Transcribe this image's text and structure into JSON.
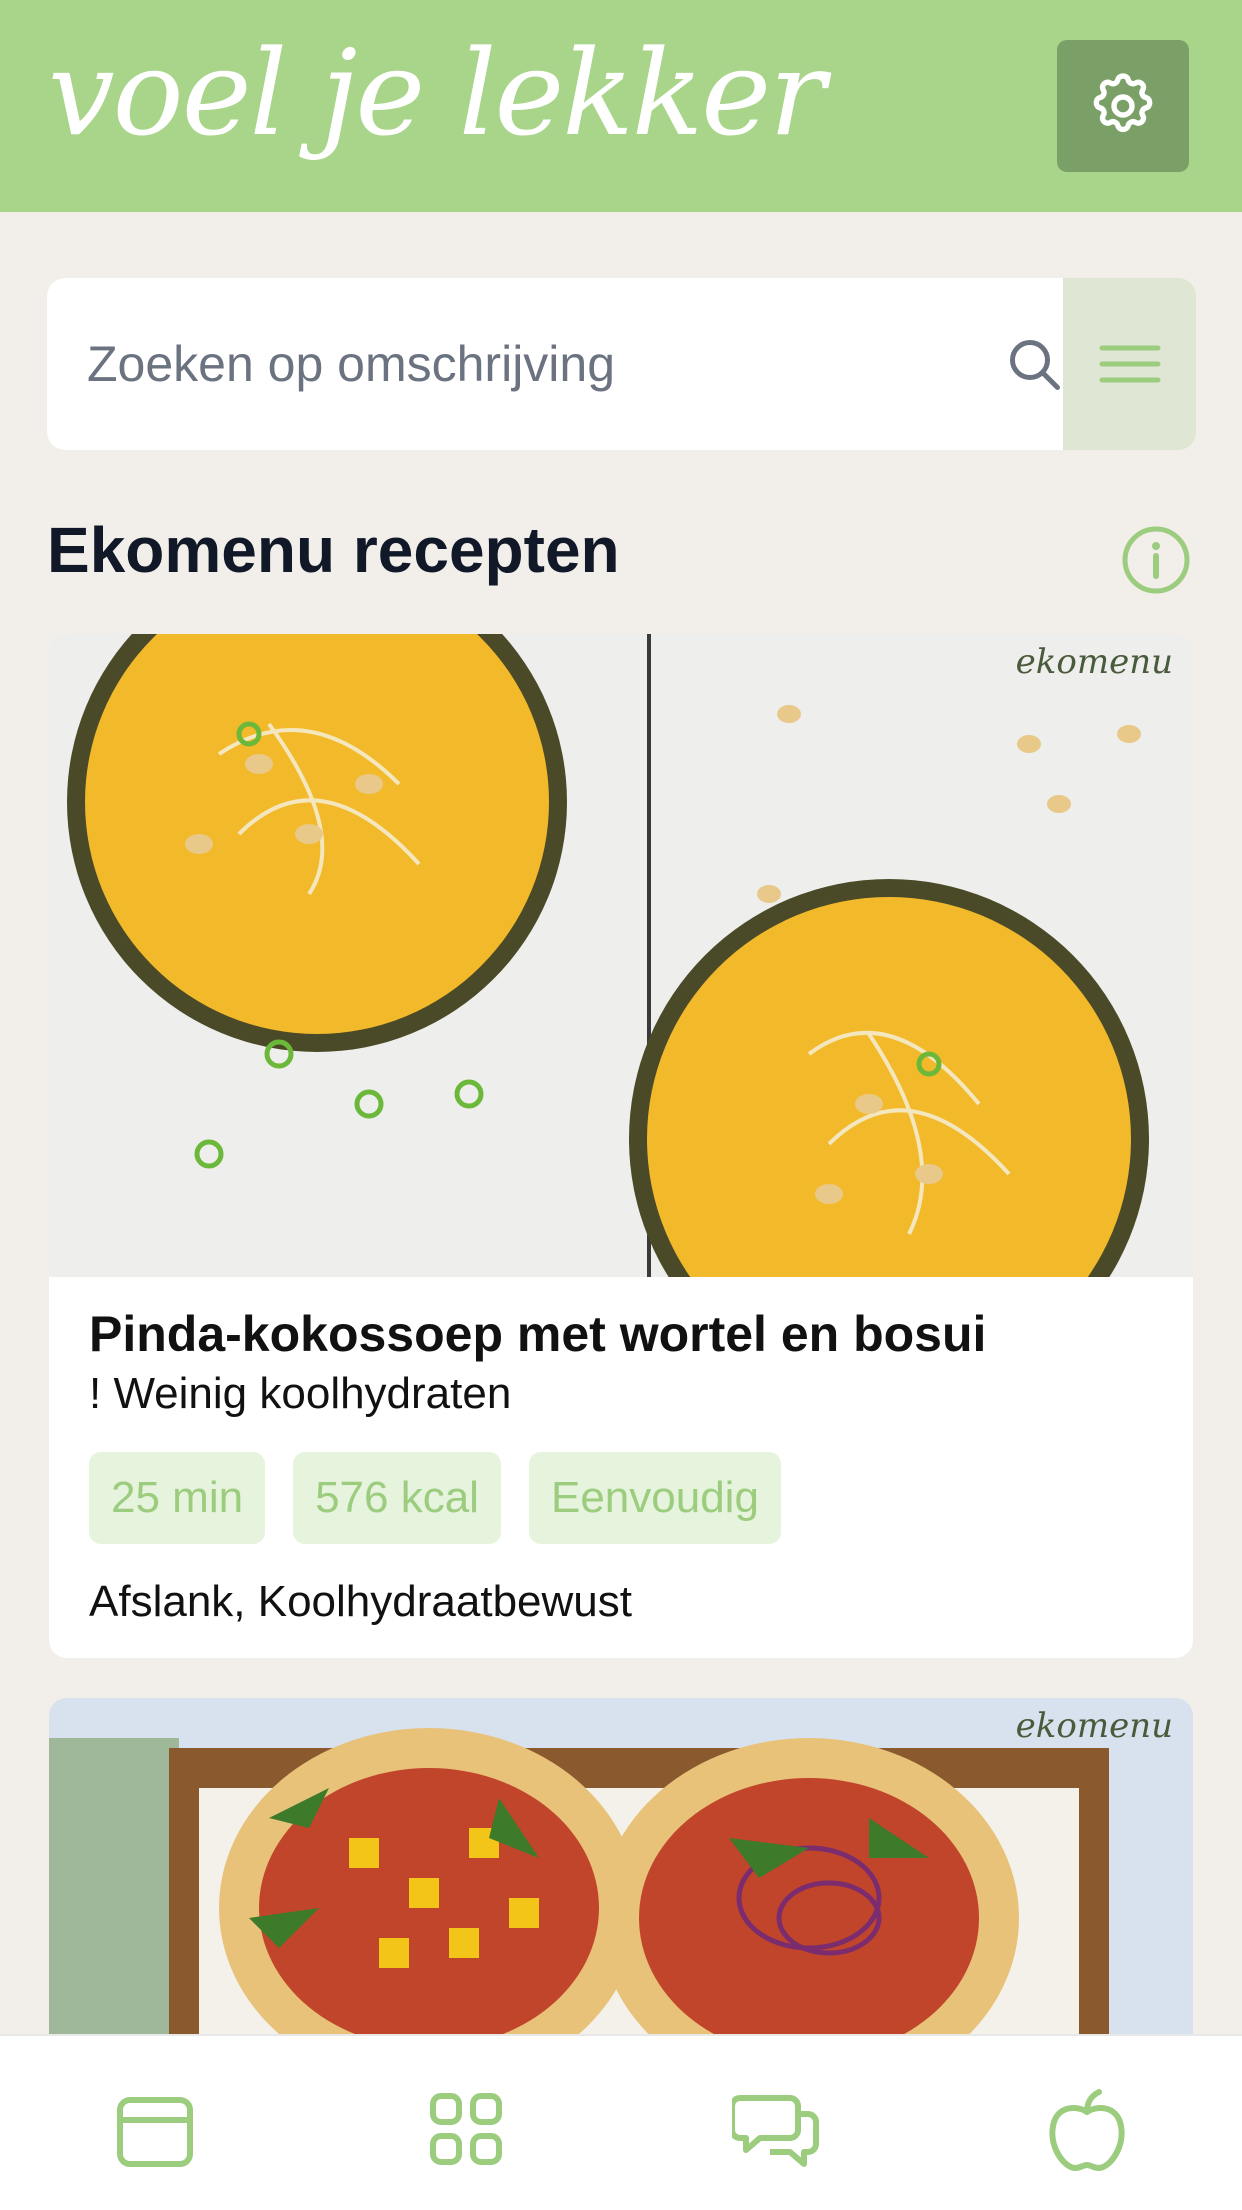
{
  "header": {
    "brand": "voel je lekker",
    "settings_icon": "gear-icon"
  },
  "search": {
    "placeholder": "Zoeken op omschrijving",
    "search_icon": "search-icon",
    "menu_icon": "hamburger-menu-icon"
  },
  "section": {
    "title": "Ekomenu recepten",
    "info_icon": "info-icon"
  },
  "recipes": [
    {
      "title": "Pinda-kokossoep met wortel en bosui",
      "subtitle": "! Weinig koolhydraten",
      "tags": [
        "25 min",
        "576 kcal",
        "Eenvoudig"
      ],
      "categories": "Afslank, Koolhydraatbewust",
      "image_logo": "ekomenu"
    },
    {
      "image_logo": "ekomenu"
    }
  ],
  "bottom_nav": [
    {
      "icon": "calendar-icon"
    },
    {
      "icon": "grid-icon"
    },
    {
      "icon": "chat-icon"
    },
    {
      "icon": "apple-icon"
    }
  ],
  "colors": {
    "accent": "#a8d58a",
    "accent_dark": "#7ba067",
    "background": "#f2eeea",
    "tag_background": "#e6f3dd",
    "tag_text": "#9ccc7e",
    "nav_icon": "#9ccc7e"
  }
}
